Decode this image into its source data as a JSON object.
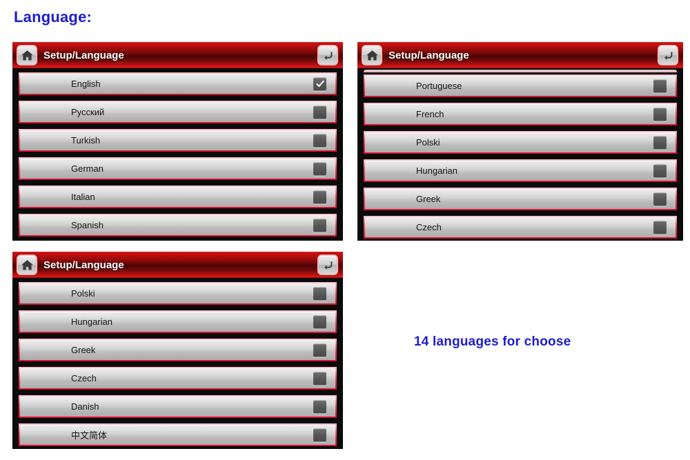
{
  "page": {
    "heading": "Language:",
    "note": "14 languages for choose",
    "accent_blue": "#1c1cd0",
    "header_red": "#c11010",
    "row_border_red": "#ef4a63",
    "panel_background": "#0b0b0b"
  },
  "icons": {
    "home": "home-icon",
    "back": "back-arrow-icon",
    "checked": "checkmark-icon",
    "unchecked": "empty-checkbox-icon"
  },
  "panels": [
    {
      "title": "Setup/Language",
      "home_label": "Home",
      "back_label": "Back",
      "partial_top_row": false,
      "rows": [
        {
          "label": "English",
          "checked": true
        },
        {
          "label": "Русский",
          "checked": false
        },
        {
          "label": "Turkish",
          "checked": false
        },
        {
          "label": "German",
          "checked": false
        },
        {
          "label": "Italian",
          "checked": false
        },
        {
          "label": "Spanish",
          "checked": false
        }
      ]
    },
    {
      "title": "Setup/Language",
      "home_label": "Home",
      "back_label": "Back",
      "partial_top_row": true,
      "rows": [
        {
          "label": "Portuguese",
          "checked": false
        },
        {
          "label": "French",
          "checked": false
        },
        {
          "label": "Polski",
          "checked": false
        },
        {
          "label": "Hungarian",
          "checked": false
        },
        {
          "label": "Greek",
          "checked": false
        },
        {
          "label": "Czech",
          "checked": false
        }
      ]
    },
    {
      "title": "Setup/Language",
      "home_label": "Home",
      "back_label": "Back",
      "partial_top_row": false,
      "rows": [
        {
          "label": "Polski",
          "checked": false
        },
        {
          "label": "Hungarian",
          "checked": false
        },
        {
          "label": "Greek",
          "checked": false
        },
        {
          "label": "Czech",
          "checked": false
        },
        {
          "label": "Danish",
          "checked": false
        },
        {
          "label": "中文简体",
          "checked": false
        }
      ]
    }
  ]
}
